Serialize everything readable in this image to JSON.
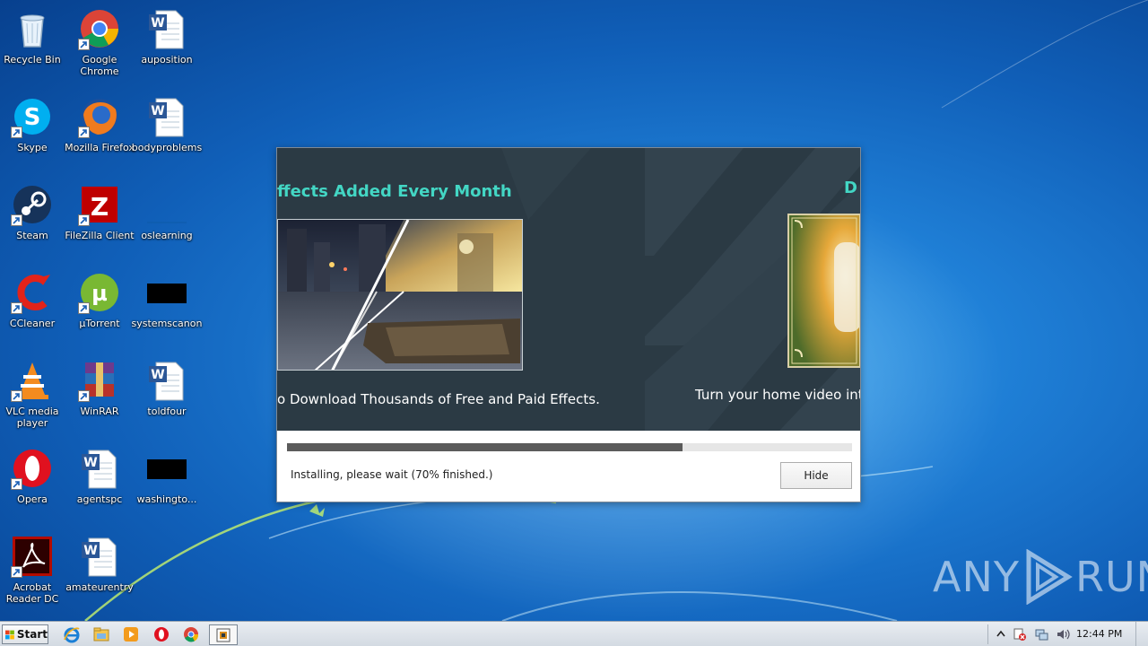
{
  "desktop": {
    "icons": [
      {
        "label": "Recycle Bin",
        "icon": "recycle-bin-icon"
      },
      {
        "label": "Google Chrome",
        "icon": "chrome-icon"
      },
      {
        "label": "auposition",
        "icon": "word-document-icon"
      },
      {
        "label": "Skype",
        "icon": "skype-icon"
      },
      {
        "label": "Mozilla Firefox",
        "icon": "firefox-icon"
      },
      {
        "label": "bodyproblems",
        "icon": "word-document-icon"
      },
      {
        "label": "Steam",
        "icon": "steam-icon"
      },
      {
        "label": "FileZilla Client",
        "icon": "filezilla-icon"
      },
      {
        "label": "oslearning",
        "icon": "blank-file-icon"
      },
      {
        "label": "CCleaner",
        "icon": "ccleaner-icon"
      },
      {
        "label": "µTorrent",
        "icon": "utorrent-icon"
      },
      {
        "label": "systemscanon",
        "icon": "black-file-icon"
      },
      {
        "label": "VLC media player",
        "icon": "vlc-icon"
      },
      {
        "label": "WinRAR",
        "icon": "winrar-icon"
      },
      {
        "label": "toldfour",
        "icon": "word-document-icon"
      },
      {
        "label": "Opera",
        "icon": "opera-icon"
      },
      {
        "label": "agentspc",
        "icon": "word-document-icon"
      },
      {
        "label": "washingto...",
        "icon": "black-file-icon"
      },
      {
        "label": "Acrobat Reader DC",
        "icon": "acrobat-icon"
      },
      {
        "label": "amateurentry",
        "icon": "word-document-icon"
      }
    ]
  },
  "installer": {
    "slide1": {
      "title": "ffects Added Every Month",
      "caption": "o Download Thousands of Free and Paid Effects."
    },
    "slide2": {
      "title": "D",
      "caption": "Turn your home video int"
    },
    "progress": 0.7,
    "status": "Installing, please wait (70% finished.)",
    "hide_label": "Hide",
    "colors": {
      "accent": "#43d6c4",
      "banner": "#2c3b45",
      "progress": "#5b5b5b"
    }
  },
  "watermark": {
    "left": "ANY",
    "right": "RUN"
  },
  "taskbar": {
    "start_label": "Start",
    "pinned": [
      "internet-explorer-icon",
      "explorer-folder-icon",
      "media-player-icon",
      "opera-icon",
      "chrome-icon",
      "installer-app-icon"
    ],
    "tray": [
      "show-hidden-icons",
      "action-center-icon",
      "network-icon",
      "volume-icon"
    ],
    "time": "12:44 PM"
  }
}
